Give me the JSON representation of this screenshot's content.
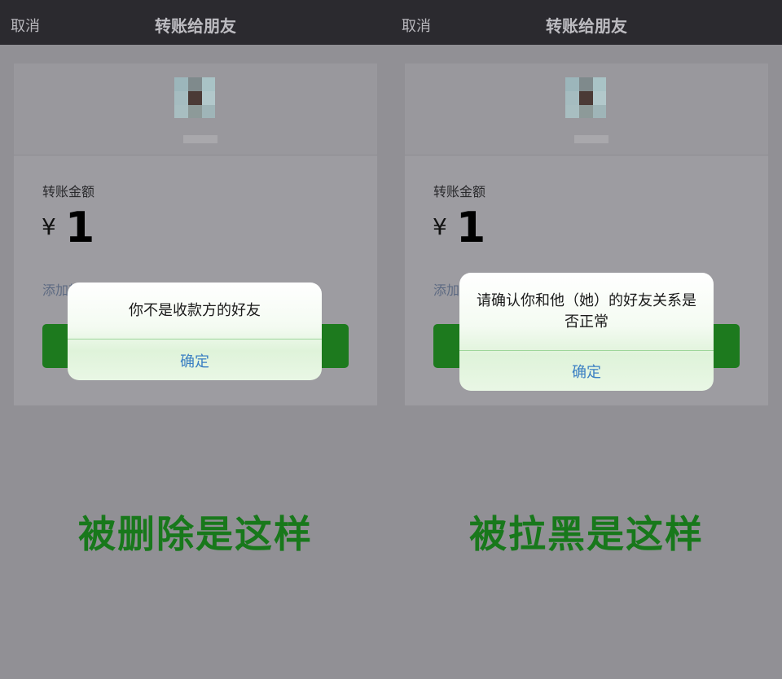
{
  "left": {
    "nav": {
      "cancel": "取消",
      "title": "转账给朋友"
    },
    "amount_label": "转账金额",
    "currency": "¥",
    "amount": "1",
    "note_link": "添加转账说明",
    "dialog": {
      "message": "你不是收款方的好友",
      "ok": "确定"
    },
    "caption": "被删除是这样"
  },
  "right": {
    "nav": {
      "cancel": "取消",
      "title": "转账给朋友"
    },
    "amount_label": "转账金额",
    "currency": "¥",
    "amount": "1",
    "note_link": "添加转账说明",
    "dialog": {
      "message": "请确认你和他（她）的好友关系是否正常",
      "ok": "确定"
    },
    "caption": "被拉黑是这样"
  },
  "colors": {
    "nav_bg": "#2b2a2f",
    "pay_button": "#1d7a1e",
    "caption": "#18781b",
    "link": "#3a7fc3"
  }
}
